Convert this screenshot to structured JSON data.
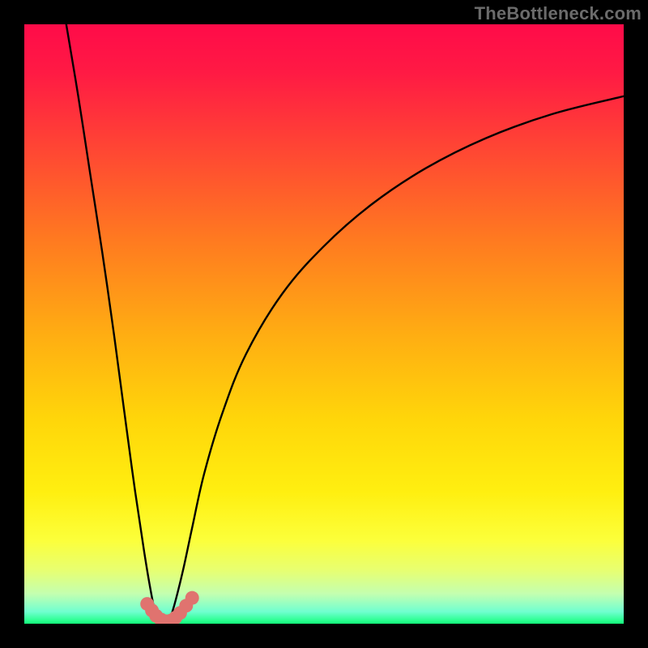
{
  "watermark": {
    "text": "TheBottleneck.com"
  },
  "chart_data": {
    "type": "line",
    "title": "",
    "xlabel": "",
    "ylabel": "",
    "xlim": [
      0,
      100
    ],
    "ylim": [
      0,
      100
    ],
    "grid": false,
    "legend": false,
    "series": [
      {
        "name": "left-branch",
        "x": [
          7,
          9,
          11,
          13,
          15,
          17,
          18.5,
          20,
          21,
          22,
          22.5
        ],
        "y": [
          100,
          88,
          75,
          62,
          48,
          33,
          22,
          12,
          6,
          1,
          0
        ]
      },
      {
        "name": "right-branch",
        "x": [
          24,
          25,
          26.5,
          28,
          30,
          33,
          37,
          43,
          50,
          58,
          67,
          77,
          88,
          100
        ],
        "y": [
          0,
          3,
          9,
          16,
          25,
          35,
          45,
          55,
          63,
          70,
          76,
          81,
          85,
          88
        ]
      },
      {
        "name": "bottom-markers",
        "mode": "markers",
        "x": [
          20.5,
          21.3,
          22.0,
          22.8,
          23.6,
          24.4,
          25.2,
          26.0,
          27.0,
          28.0
        ],
        "y": [
          3.3,
          2.2,
          1.3,
          0.7,
          0.4,
          0.5,
          1.0,
          1.8,
          3.0,
          4.3
        ]
      }
    ],
    "colors": {
      "curve": "#000000",
      "markers": "#e0736f",
      "gradient_top": "#ff0b49",
      "gradient_bottom": "#12ff7a"
    }
  }
}
